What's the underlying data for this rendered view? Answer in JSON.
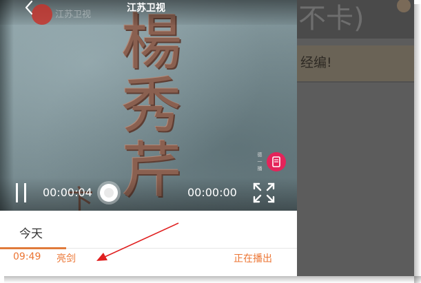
{
  "player": {
    "channel_title": "江苏卫视",
    "logo_text": "江苏卫视",
    "watermark_label": "德一播",
    "time_current": "00:00:04",
    "time_total": "00:00:00",
    "progress": 0.0
  },
  "video": {
    "calligraphy_chars": [
      "楊",
      "秀",
      "芹"
    ],
    "edge_char": "卞"
  },
  "schedule": {
    "tabs": [
      {
        "label": "今天"
      }
    ],
    "items": [
      {
        "time": "09:49",
        "name": "亮剑",
        "status": "正在播出"
      }
    ]
  },
  "background": {
    "header_text": "不卡)",
    "banner_text": "经编!"
  },
  "colors": {
    "accent": "#ec7533",
    "annotation_arrow": "#e02020",
    "mark_badge": "#e4245a"
  }
}
